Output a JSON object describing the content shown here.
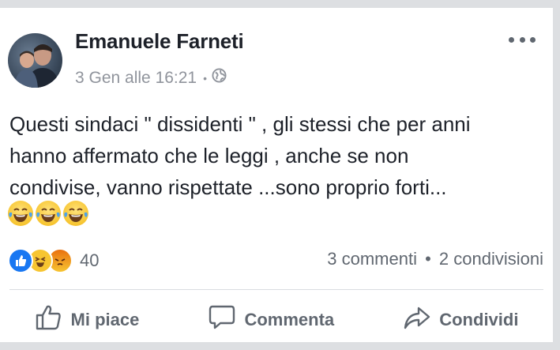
{
  "post": {
    "author": "Emanuele Farneti",
    "timestamp": "3 Gen alle 16:21",
    "privacy_icon": "globe-icon",
    "more_icon": "more-options-icon",
    "text_lines": [
      "Questi sindaci \" dissidenti \" , gli stessi che per anni",
      "hanno affermato che le leggi , anche se non",
      "condivise, vanno rispettate ...sono proprio forti..."
    ],
    "emojis": [
      "tears-of-joy-emoji",
      "tears-of-joy-emoji",
      "tears-of-joy-emoji"
    ]
  },
  "reactions": {
    "icons": [
      "like-icon",
      "haha-icon",
      "angry-icon"
    ],
    "count": "40",
    "comments": "3 commenti",
    "separator": "•",
    "shares": "2 condivisioni"
  },
  "actions": {
    "like": "Mi piace",
    "comment": "Commenta",
    "share": "Condividi"
  },
  "colors": {
    "text": "#1d2129",
    "secondary": "#606770",
    "like_blue": "#1877f2"
  }
}
